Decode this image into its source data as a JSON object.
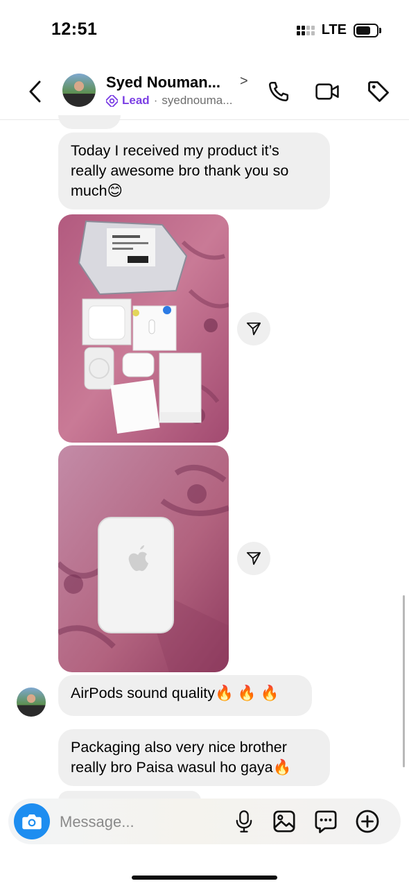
{
  "status_bar": {
    "time": "12:51",
    "network": "LTE",
    "battery_level": 0.7
  },
  "header": {
    "name": "Syed Nouman...",
    "chevron": ">",
    "label": "Lead",
    "separator": "·",
    "username": "syednouma..."
  },
  "messages": [
    {
      "type": "text",
      "text": "Today I received my product it’s really awesome bro thank you so much😊"
    },
    {
      "type": "photo",
      "subject": "unboxed AirPods Pro, MagSafe battery pack and packaging on pink cloth"
    },
    {
      "type": "photo",
      "subject": "MagSafe battery pack with Apple logo on pink cloth"
    },
    {
      "type": "text",
      "text": "AirPods sound quality🔥 🔥 🔥"
    },
    {
      "type": "text",
      "text": "Packaging also very nice brother really bro Paisa wasul ho gaya🔥"
    }
  ],
  "composer": {
    "placeholder": "Message..."
  },
  "icons": {
    "back": "chevron-left-icon",
    "call": "phone-icon",
    "video": "video-icon",
    "tag": "tag-icon",
    "lead": "lead-badge-icon",
    "share": "paper-plane-icon",
    "camera": "camera-icon",
    "mic": "microphone-icon",
    "gallery": "gallery-icon",
    "sticker": "chat-bubble-icon",
    "more": "plus-icon"
  },
  "colors": {
    "accent": "#1d8df0",
    "lead": "#7b3fe4",
    "bubble": "#efefef"
  }
}
